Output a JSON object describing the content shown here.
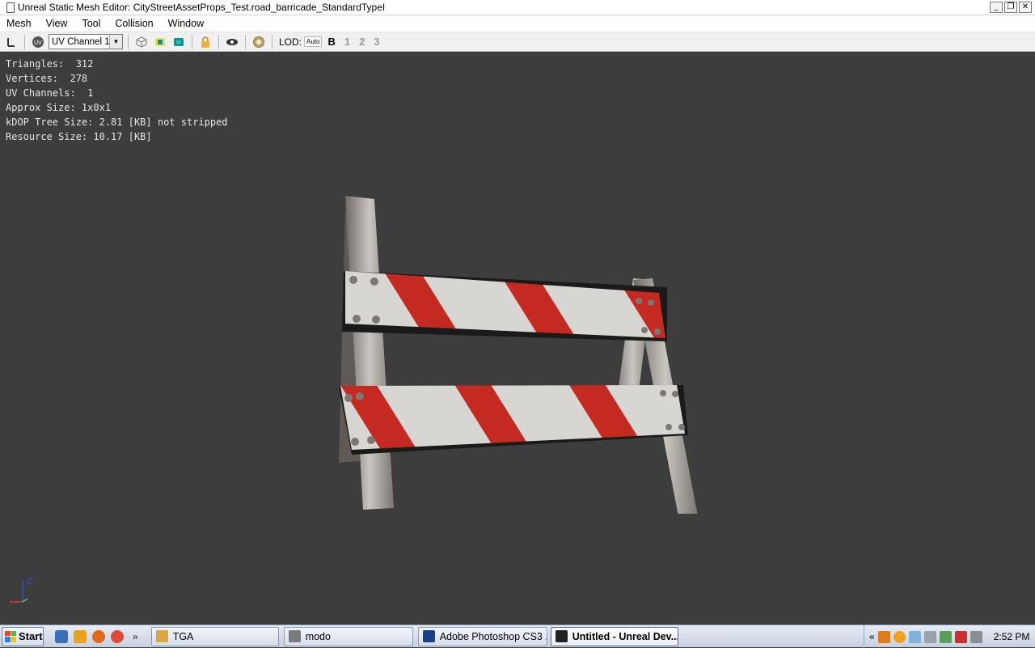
{
  "window": {
    "title": "Unreal Static Mesh Editor: CityStreetAssetProps_Test.road_barricade_StandardTypeI",
    "minimize": "_",
    "restore": "❐",
    "close": "✕"
  },
  "menu": [
    "Mesh",
    "View",
    "Tool",
    "Collision",
    "Window"
  ],
  "toolbar": {
    "uv_channel": "UV Channel 1",
    "lod_label": "LOD:",
    "lod_auto": "Auto",
    "lod_levels": [
      "B",
      "1",
      "2",
      "3"
    ]
  },
  "stats": [
    "Triangles:  312",
    "Vertices:  278",
    "UV Channels:  1",
    "Approx Size: 1x0x1",
    "kDOP Tree Size: 2.81 [KB] not stripped",
    "Resource Size: 10.17 [KB]"
  ],
  "axis": {
    "z_label": "Z"
  },
  "taskbar": {
    "start": "Start",
    "overflow": "»",
    "tasks": [
      {
        "label": "TGA",
        "color": "#d9a640"
      },
      {
        "label": "modo",
        "color": "#7a7a7a"
      },
      {
        "label": "Adobe Photoshop CS3 ...",
        "color": "#1c3f8a"
      },
      {
        "label": "Untitled - Unreal Dev...",
        "color": "#222222"
      }
    ],
    "tray_expand": "«",
    "clock": "2:52 PM"
  },
  "colors": {
    "viewport": "#3d3d3d",
    "stats_text": "#e6e6e6",
    "barricade_red": "#c42a22",
    "barricade_white": "#d8d6d2"
  }
}
